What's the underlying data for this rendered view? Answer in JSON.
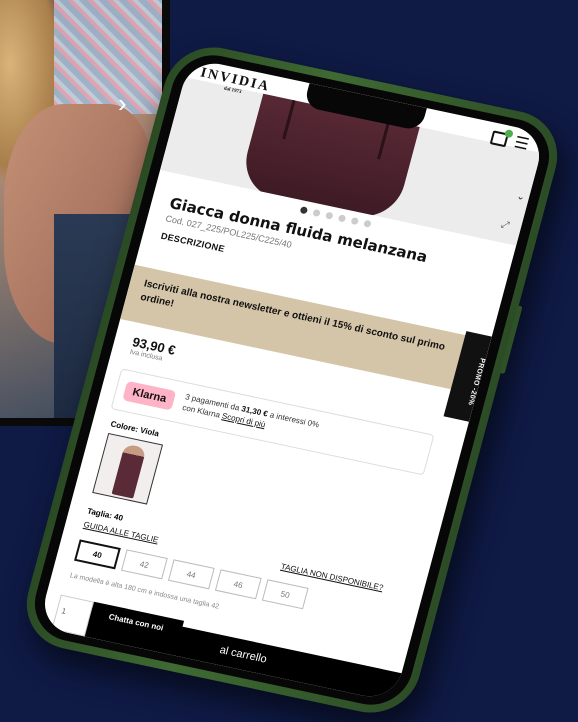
{
  "header": {
    "brand": "INVIDIA",
    "brand_sub": "dal 1973"
  },
  "gallery": {
    "slide_count": 6,
    "active_index": 0
  },
  "product": {
    "title": "Giacca donna fluida melanzana",
    "code": "Cod. 027_225/POL225/C225/40",
    "description_label": "DESCRIZIONE"
  },
  "newsletter": {
    "text": "Iscriviti alla nostra newsletter e ottieni il 15% di sconto sul primo ordine!"
  },
  "promo_tab": "PROMO -20%",
  "pricing": {
    "price": "93,90 €",
    "vat_note": "Iva inclusa"
  },
  "klarna": {
    "logo": "Klarna",
    "line1_prefix": "3 pagamenti da ",
    "installment": "31,30 €",
    "line1_suffix": " a interessi 0%",
    "line2_prefix": "con Klarna ",
    "learn_more": "Scopri di più"
  },
  "color": {
    "label": "Colore: Viola"
  },
  "size": {
    "label": "Taglia: 40",
    "guide_link": "GUIDA ALLE TAGLIE",
    "unavailable_link": "TAGLIA NON DISPONIBILE?",
    "options": [
      "40",
      "42",
      "44",
      "46",
      "50"
    ],
    "selected": "40",
    "model_note": "La modella è alta 180 cm e indossa una taglia 42"
  },
  "bottom": {
    "quantity": "1",
    "chat_label": "Chatta con noi",
    "add_to_cart": "al carrello"
  }
}
